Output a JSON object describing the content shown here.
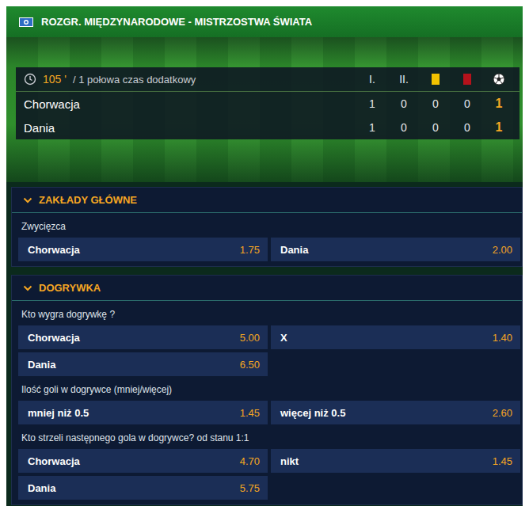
{
  "header": {
    "title": "ROZGR. MIĘDZYNARODOWE - MISTRZOSTWA ŚWIATA"
  },
  "scoreboard": {
    "time": "105 '",
    "period": "/ 1 połowa czas dodatkowy",
    "columns": [
      {
        "kind": "text",
        "label": "I."
      },
      {
        "kind": "text",
        "label": "II."
      },
      {
        "kind": "yellow-card"
      },
      {
        "kind": "red-card"
      },
      {
        "kind": "goals"
      }
    ],
    "teams": [
      {
        "name": "Chorwacja",
        "values": [
          "1",
          "0",
          "0",
          "0",
          "1"
        ]
      },
      {
        "name": "Dania",
        "values": [
          "1",
          "0",
          "0",
          "0",
          "1"
        ]
      }
    ]
  },
  "sections": [
    {
      "title": "ZAKŁADY GŁÓWNE",
      "expanded": true,
      "markets": [
        {
          "title": "Zwycięzca",
          "outcomes": [
            {
              "label": "Chorwacja",
              "odds": "1.75"
            },
            {
              "label": "Dania",
              "odds": "2.00"
            }
          ]
        }
      ]
    },
    {
      "title": "DOGRYWKA",
      "expanded": true,
      "markets": [
        {
          "title": "Kto wygra dogrywkę ?",
          "outcomes": [
            {
              "label": "Chorwacja",
              "odds": "5.00"
            },
            {
              "label": "X",
              "odds": "1.40"
            },
            {
              "label": "Dania",
              "odds": "6.50"
            }
          ]
        },
        {
          "title": "Ilość goli w dogrywce (mniej/więcej)",
          "outcomes": [
            {
              "label": "mniej niż 0.5",
              "odds": "1.45"
            },
            {
              "label": "więcej niż 0.5",
              "odds": "2.60"
            }
          ]
        },
        {
          "title": "Kto strzeli następnego gola w dogrywce? od stanu 1:1",
          "outcomes": [
            {
              "label": "Chorwacja",
              "odds": "4.70"
            },
            {
              "label": "nikt",
              "odds": "1.45"
            },
            {
              "label": "Dania",
              "odds": "5.75"
            }
          ]
        }
      ]
    }
  ]
}
